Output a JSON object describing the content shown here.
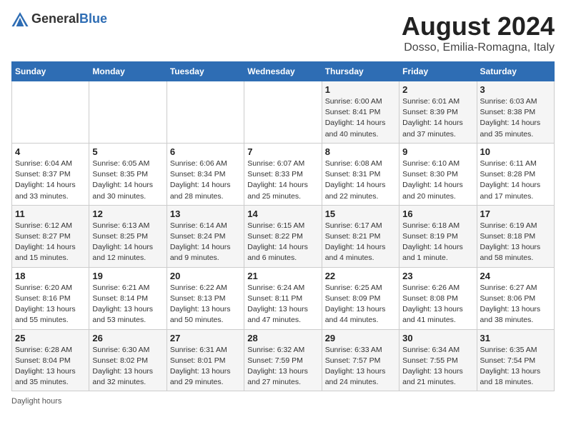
{
  "header": {
    "logo_general": "General",
    "logo_blue": "Blue",
    "month_title": "August 2024",
    "location": "Dosso, Emilia-Romagna, Italy"
  },
  "days_of_week": [
    "Sunday",
    "Monday",
    "Tuesday",
    "Wednesday",
    "Thursday",
    "Friday",
    "Saturday"
  ],
  "footer_note": "Daylight hours",
  "weeks": [
    [
      {
        "day": "",
        "sunrise": "",
        "sunset": "",
        "daylight": ""
      },
      {
        "day": "",
        "sunrise": "",
        "sunset": "",
        "daylight": ""
      },
      {
        "day": "",
        "sunrise": "",
        "sunset": "",
        "daylight": ""
      },
      {
        "day": "",
        "sunrise": "",
        "sunset": "",
        "daylight": ""
      },
      {
        "day": "1",
        "sunrise": "Sunrise: 6:00 AM",
        "sunset": "Sunset: 8:41 PM",
        "daylight": "Daylight: 14 hours and 40 minutes."
      },
      {
        "day": "2",
        "sunrise": "Sunrise: 6:01 AM",
        "sunset": "Sunset: 8:39 PM",
        "daylight": "Daylight: 14 hours and 37 minutes."
      },
      {
        "day": "3",
        "sunrise": "Sunrise: 6:03 AM",
        "sunset": "Sunset: 8:38 PM",
        "daylight": "Daylight: 14 hours and 35 minutes."
      }
    ],
    [
      {
        "day": "4",
        "sunrise": "Sunrise: 6:04 AM",
        "sunset": "Sunset: 8:37 PM",
        "daylight": "Daylight: 14 hours and 33 minutes."
      },
      {
        "day": "5",
        "sunrise": "Sunrise: 6:05 AM",
        "sunset": "Sunset: 8:35 PM",
        "daylight": "Daylight: 14 hours and 30 minutes."
      },
      {
        "day": "6",
        "sunrise": "Sunrise: 6:06 AM",
        "sunset": "Sunset: 8:34 PM",
        "daylight": "Daylight: 14 hours and 28 minutes."
      },
      {
        "day": "7",
        "sunrise": "Sunrise: 6:07 AM",
        "sunset": "Sunset: 8:33 PM",
        "daylight": "Daylight: 14 hours and 25 minutes."
      },
      {
        "day": "8",
        "sunrise": "Sunrise: 6:08 AM",
        "sunset": "Sunset: 8:31 PM",
        "daylight": "Daylight: 14 hours and 22 minutes."
      },
      {
        "day": "9",
        "sunrise": "Sunrise: 6:10 AM",
        "sunset": "Sunset: 8:30 PM",
        "daylight": "Daylight: 14 hours and 20 minutes."
      },
      {
        "day": "10",
        "sunrise": "Sunrise: 6:11 AM",
        "sunset": "Sunset: 8:28 PM",
        "daylight": "Daylight: 14 hours and 17 minutes."
      }
    ],
    [
      {
        "day": "11",
        "sunrise": "Sunrise: 6:12 AM",
        "sunset": "Sunset: 8:27 PM",
        "daylight": "Daylight: 14 hours and 15 minutes."
      },
      {
        "day": "12",
        "sunrise": "Sunrise: 6:13 AM",
        "sunset": "Sunset: 8:25 PM",
        "daylight": "Daylight: 14 hours and 12 minutes."
      },
      {
        "day": "13",
        "sunrise": "Sunrise: 6:14 AM",
        "sunset": "Sunset: 8:24 PM",
        "daylight": "Daylight: 14 hours and 9 minutes."
      },
      {
        "day": "14",
        "sunrise": "Sunrise: 6:15 AM",
        "sunset": "Sunset: 8:22 PM",
        "daylight": "Daylight: 14 hours and 6 minutes."
      },
      {
        "day": "15",
        "sunrise": "Sunrise: 6:17 AM",
        "sunset": "Sunset: 8:21 PM",
        "daylight": "Daylight: 14 hours and 4 minutes."
      },
      {
        "day": "16",
        "sunrise": "Sunrise: 6:18 AM",
        "sunset": "Sunset: 8:19 PM",
        "daylight": "Daylight: 14 hours and 1 minute."
      },
      {
        "day": "17",
        "sunrise": "Sunrise: 6:19 AM",
        "sunset": "Sunset: 8:18 PM",
        "daylight": "Daylight: 13 hours and 58 minutes."
      }
    ],
    [
      {
        "day": "18",
        "sunrise": "Sunrise: 6:20 AM",
        "sunset": "Sunset: 8:16 PM",
        "daylight": "Daylight: 13 hours and 55 minutes."
      },
      {
        "day": "19",
        "sunrise": "Sunrise: 6:21 AM",
        "sunset": "Sunset: 8:14 PM",
        "daylight": "Daylight: 13 hours and 53 minutes."
      },
      {
        "day": "20",
        "sunrise": "Sunrise: 6:22 AM",
        "sunset": "Sunset: 8:13 PM",
        "daylight": "Daylight: 13 hours and 50 minutes."
      },
      {
        "day": "21",
        "sunrise": "Sunrise: 6:24 AM",
        "sunset": "Sunset: 8:11 PM",
        "daylight": "Daylight: 13 hours and 47 minutes."
      },
      {
        "day": "22",
        "sunrise": "Sunrise: 6:25 AM",
        "sunset": "Sunset: 8:09 PM",
        "daylight": "Daylight: 13 hours and 44 minutes."
      },
      {
        "day": "23",
        "sunrise": "Sunrise: 6:26 AM",
        "sunset": "Sunset: 8:08 PM",
        "daylight": "Daylight: 13 hours and 41 minutes."
      },
      {
        "day": "24",
        "sunrise": "Sunrise: 6:27 AM",
        "sunset": "Sunset: 8:06 PM",
        "daylight": "Daylight: 13 hours and 38 minutes."
      }
    ],
    [
      {
        "day": "25",
        "sunrise": "Sunrise: 6:28 AM",
        "sunset": "Sunset: 8:04 PM",
        "daylight": "Daylight: 13 hours and 35 minutes."
      },
      {
        "day": "26",
        "sunrise": "Sunrise: 6:30 AM",
        "sunset": "Sunset: 8:02 PM",
        "daylight": "Daylight: 13 hours and 32 minutes."
      },
      {
        "day": "27",
        "sunrise": "Sunrise: 6:31 AM",
        "sunset": "Sunset: 8:01 PM",
        "daylight": "Daylight: 13 hours and 29 minutes."
      },
      {
        "day": "28",
        "sunrise": "Sunrise: 6:32 AM",
        "sunset": "Sunset: 7:59 PM",
        "daylight": "Daylight: 13 hours and 27 minutes."
      },
      {
        "day": "29",
        "sunrise": "Sunrise: 6:33 AM",
        "sunset": "Sunset: 7:57 PM",
        "daylight": "Daylight: 13 hours and 24 minutes."
      },
      {
        "day": "30",
        "sunrise": "Sunrise: 6:34 AM",
        "sunset": "Sunset: 7:55 PM",
        "daylight": "Daylight: 13 hours and 21 minutes."
      },
      {
        "day": "31",
        "sunrise": "Sunrise: 6:35 AM",
        "sunset": "Sunset: 7:54 PM",
        "daylight": "Daylight: 13 hours and 18 minutes."
      }
    ]
  ]
}
